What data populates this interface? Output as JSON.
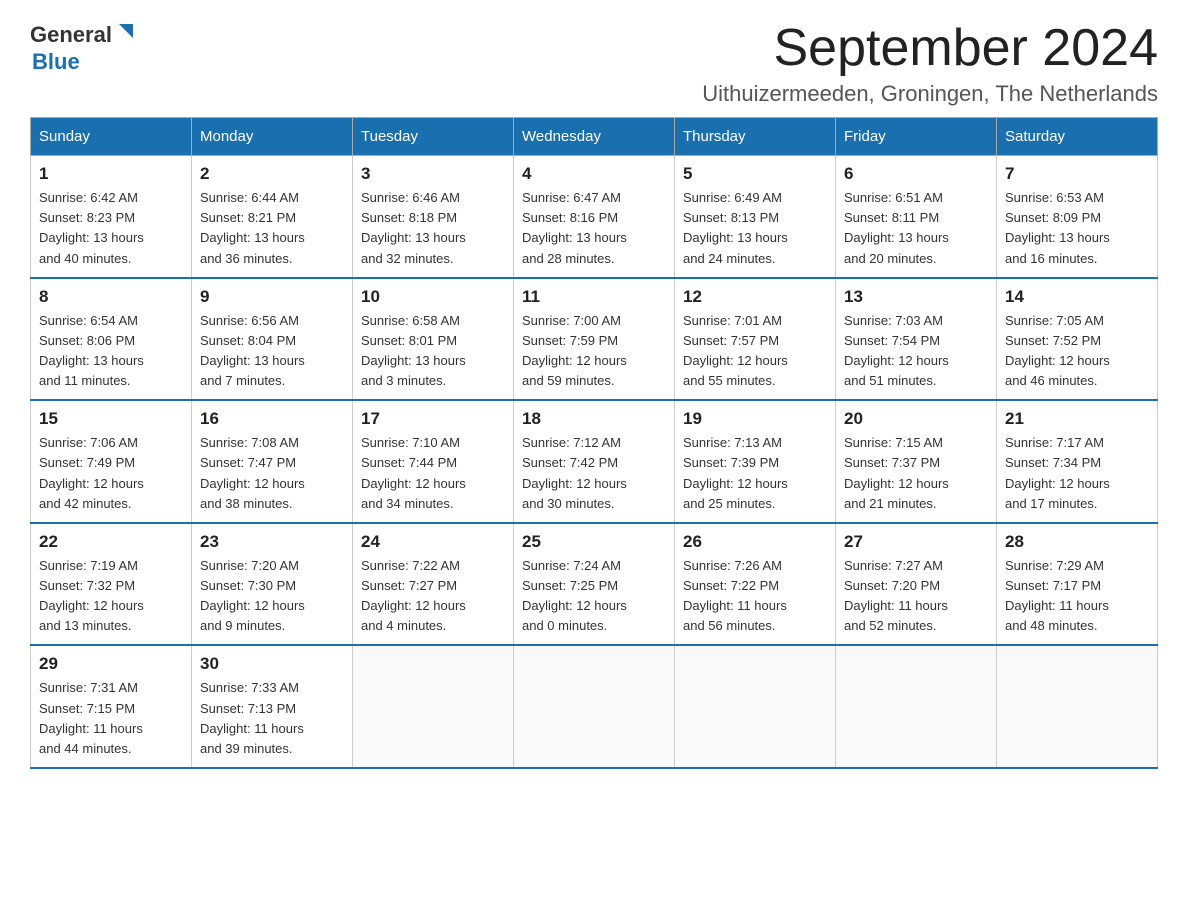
{
  "logo": {
    "text_general": "General",
    "triangle_symbol": "▶",
    "text_blue": "Blue"
  },
  "title": "September 2024",
  "location": "Uithuizermeeden, Groningen, The Netherlands",
  "days_of_week": [
    "Sunday",
    "Monday",
    "Tuesday",
    "Wednesday",
    "Thursday",
    "Friday",
    "Saturday"
  ],
  "weeks": [
    [
      {
        "day": "1",
        "sunrise": "6:42 AM",
        "sunset": "8:23 PM",
        "daylight": "13 hours and 40 minutes."
      },
      {
        "day": "2",
        "sunrise": "6:44 AM",
        "sunset": "8:21 PM",
        "daylight": "13 hours and 36 minutes."
      },
      {
        "day": "3",
        "sunrise": "6:46 AM",
        "sunset": "8:18 PM",
        "daylight": "13 hours and 32 minutes."
      },
      {
        "day": "4",
        "sunrise": "6:47 AM",
        "sunset": "8:16 PM",
        "daylight": "13 hours and 28 minutes."
      },
      {
        "day": "5",
        "sunrise": "6:49 AM",
        "sunset": "8:13 PM",
        "daylight": "13 hours and 24 minutes."
      },
      {
        "day": "6",
        "sunrise": "6:51 AM",
        "sunset": "8:11 PM",
        "daylight": "13 hours and 20 minutes."
      },
      {
        "day": "7",
        "sunrise": "6:53 AM",
        "sunset": "8:09 PM",
        "daylight": "13 hours and 16 minutes."
      }
    ],
    [
      {
        "day": "8",
        "sunrise": "6:54 AM",
        "sunset": "8:06 PM",
        "daylight": "13 hours and 11 minutes."
      },
      {
        "day": "9",
        "sunrise": "6:56 AM",
        "sunset": "8:04 PM",
        "daylight": "13 hours and 7 minutes."
      },
      {
        "day": "10",
        "sunrise": "6:58 AM",
        "sunset": "8:01 PM",
        "daylight": "13 hours and 3 minutes."
      },
      {
        "day": "11",
        "sunrise": "7:00 AM",
        "sunset": "7:59 PM",
        "daylight": "12 hours and 59 minutes."
      },
      {
        "day": "12",
        "sunrise": "7:01 AM",
        "sunset": "7:57 PM",
        "daylight": "12 hours and 55 minutes."
      },
      {
        "day": "13",
        "sunrise": "7:03 AM",
        "sunset": "7:54 PM",
        "daylight": "12 hours and 51 minutes."
      },
      {
        "day": "14",
        "sunrise": "7:05 AM",
        "sunset": "7:52 PM",
        "daylight": "12 hours and 46 minutes."
      }
    ],
    [
      {
        "day": "15",
        "sunrise": "7:06 AM",
        "sunset": "7:49 PM",
        "daylight": "12 hours and 42 minutes."
      },
      {
        "day": "16",
        "sunrise": "7:08 AM",
        "sunset": "7:47 PM",
        "daylight": "12 hours and 38 minutes."
      },
      {
        "day": "17",
        "sunrise": "7:10 AM",
        "sunset": "7:44 PM",
        "daylight": "12 hours and 34 minutes."
      },
      {
        "day": "18",
        "sunrise": "7:12 AM",
        "sunset": "7:42 PM",
        "daylight": "12 hours and 30 minutes."
      },
      {
        "day": "19",
        "sunrise": "7:13 AM",
        "sunset": "7:39 PM",
        "daylight": "12 hours and 25 minutes."
      },
      {
        "day": "20",
        "sunrise": "7:15 AM",
        "sunset": "7:37 PM",
        "daylight": "12 hours and 21 minutes."
      },
      {
        "day": "21",
        "sunrise": "7:17 AM",
        "sunset": "7:34 PM",
        "daylight": "12 hours and 17 minutes."
      }
    ],
    [
      {
        "day": "22",
        "sunrise": "7:19 AM",
        "sunset": "7:32 PM",
        "daylight": "12 hours and 13 minutes."
      },
      {
        "day": "23",
        "sunrise": "7:20 AM",
        "sunset": "7:30 PM",
        "daylight": "12 hours and 9 minutes."
      },
      {
        "day": "24",
        "sunrise": "7:22 AM",
        "sunset": "7:27 PM",
        "daylight": "12 hours and 4 minutes."
      },
      {
        "day": "25",
        "sunrise": "7:24 AM",
        "sunset": "7:25 PM",
        "daylight": "12 hours and 0 minutes."
      },
      {
        "day": "26",
        "sunrise": "7:26 AM",
        "sunset": "7:22 PM",
        "daylight": "11 hours and 56 minutes."
      },
      {
        "day": "27",
        "sunrise": "7:27 AM",
        "sunset": "7:20 PM",
        "daylight": "11 hours and 52 minutes."
      },
      {
        "day": "28",
        "sunrise": "7:29 AM",
        "sunset": "7:17 PM",
        "daylight": "11 hours and 48 minutes."
      }
    ],
    [
      {
        "day": "29",
        "sunrise": "7:31 AM",
        "sunset": "7:15 PM",
        "daylight": "11 hours and 44 minutes."
      },
      {
        "day": "30",
        "sunrise": "7:33 AM",
        "sunset": "7:13 PM",
        "daylight": "11 hours and 39 minutes."
      },
      null,
      null,
      null,
      null,
      null
    ]
  ]
}
